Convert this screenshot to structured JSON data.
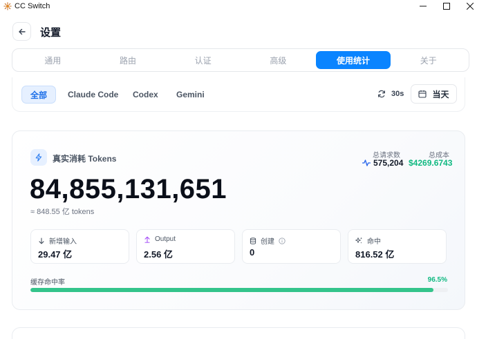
{
  "window": {
    "title": "CC Switch",
    "icons": [
      "app-logo-icon",
      "minimize-icon",
      "maximize-icon",
      "close-icon"
    ]
  },
  "header": {
    "title": "设置",
    "back_icon": "arrow-left-icon"
  },
  "tabs": [
    {
      "label": "通用",
      "active": false
    },
    {
      "label": "路由",
      "active": false
    },
    {
      "label": "认证",
      "active": false
    },
    {
      "label": "高级",
      "active": false
    },
    {
      "label": "使用统计",
      "active": true
    },
    {
      "label": "关于",
      "active": false
    }
  ],
  "filters": {
    "providers": [
      {
        "label": "全部",
        "active": true
      },
      {
        "label": "Claude Code",
        "active": false
      },
      {
        "label": "Codex",
        "active": false
      },
      {
        "label": "Gemini",
        "active": false
      }
    ],
    "refresh_interval": "30s",
    "range_label": "当天"
  },
  "stats": {
    "label": "真实消耗 Tokens",
    "total_requests_label": "总请求数",
    "total_requests": "575,204",
    "total_cost_label": "总成本",
    "total_cost": "$4269.6743",
    "big_number": "84,855,131,651",
    "approx": "≈ 848.55 亿 tokens",
    "cards": [
      {
        "label": "新增输入",
        "value": "29.47 亿",
        "icon": "arrow-down-icon"
      },
      {
        "label": "Output",
        "value": "2.56 亿",
        "icon": "arrow-up-icon"
      },
      {
        "label": "创建",
        "value": "0",
        "icon": "database-icon"
      },
      {
        "label": "命中",
        "value": "816.52 亿",
        "icon": "sparkles-icon"
      }
    ],
    "cache_hit_label": "缓存命中率",
    "cache_hit_pct": "96.5%",
    "cache_hit_fraction": 0.965
  },
  "colors": {
    "accent": "#0a84ff",
    "success": "#10b981",
    "hit_bar": "#34c48b"
  }
}
